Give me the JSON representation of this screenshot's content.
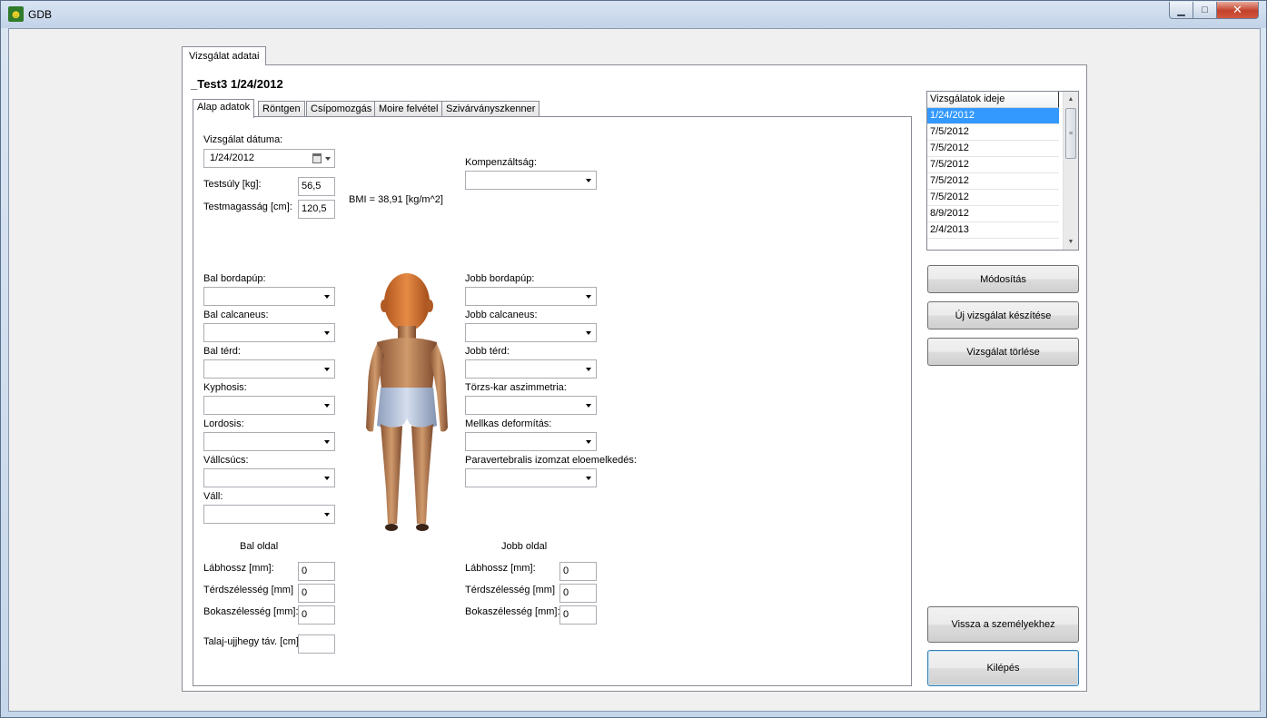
{
  "window": {
    "title": "GDB"
  },
  "outer_tab": "Vizsgálat adatai",
  "exam_header": "_Test3   1/24/2012",
  "inner_tabs": [
    "Alap adatok",
    "Röntgen",
    "Csípomozgás",
    "Moire felvétel",
    "Szivárványszkenner"
  ],
  "basic": {
    "exam_date_label": "Vizsgálat dátuma:",
    "exam_date_value": "1/24/2012",
    "weight_label": "Testsúly [kg]:",
    "weight_value": "56,5",
    "height_label": "Testmagasság [cm]:",
    "height_value": "120,5",
    "bmi_text": "BMI = 38,91 [kg/m^2]",
    "compensation_label": "Kompenzáltság:"
  },
  "left_combos": [
    "Bal bordapúp:",
    "Bal calcaneus:",
    "Bal térd:",
    "Kyphosis:",
    "Lordosis:",
    "Vállcsúcs:",
    "Váll:"
  ],
  "right_combos": [
    "Jobb bordapúp:",
    "Jobb calcaneus:",
    "Jobb térd:",
    "Törzs-kar aszimmetria:",
    "Mellkas deformítás:",
    "Paravertebralis izomzat eloemelkedés:"
  ],
  "left_side": {
    "heading": "Bal oldal",
    "fields": [
      {
        "label": "Lábhossz [mm]:",
        "value": "0"
      },
      {
        "label": "Térdszélesség [mm]",
        "value": "0"
      },
      {
        "label": "Bokaszélesség [mm]:",
        "value": "0"
      }
    ]
  },
  "right_side": {
    "heading": "Jobb oldal",
    "fields": [
      {
        "label": "Lábhossz [mm]:",
        "value": "0"
      },
      {
        "label": "Térdszélesség [mm]",
        "value": "0"
      },
      {
        "label": "Bokaszélesség [mm]:",
        "value": "0"
      }
    ]
  },
  "floor_distance": {
    "label": "Talaj-ujjhegy táv. [cm]",
    "value": ""
  },
  "exam_list": {
    "header": "Vizsgálatok ideje",
    "rows": [
      "1/24/2012",
      "7/5/2012",
      "7/5/2012",
      "7/5/2012",
      "7/5/2012",
      "7/5/2012",
      "8/9/2012",
      "2/4/2013"
    ],
    "selected_index": 0
  },
  "buttons": {
    "modify": "Módosítás",
    "new_exam": "Új vizsgálat készítése",
    "delete_exam": "Vizsgálat törlése",
    "back": "Vissza a személyekhez",
    "exit": "Kilépés"
  },
  "colors": {
    "selection": "#3399ff",
    "skin": "#c98a5c",
    "shorts": "#b9c8e0"
  }
}
